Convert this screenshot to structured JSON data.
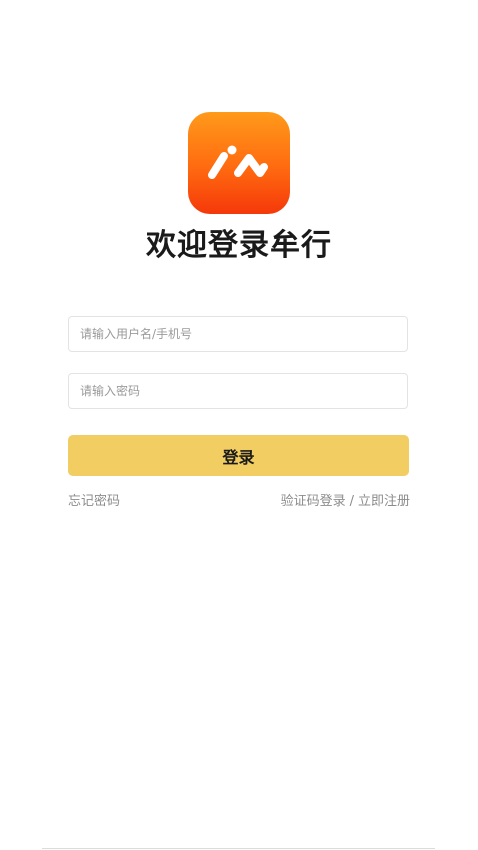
{
  "app": {
    "logo_icon": "mountain-logo-icon",
    "logo_colors": [
      "#ff9a1a",
      "#f5380a"
    ],
    "welcome_title": "欢迎登录牟行"
  },
  "form": {
    "username_placeholder": "请输入用户名/手机号",
    "password_placeholder": "请输入密码",
    "login_label": "登录",
    "login_color": "#f1cd62"
  },
  "links": {
    "forgot_password": "忘记密码",
    "sms_login": "验证码登录",
    "separator": "/",
    "register": "立即注册"
  }
}
